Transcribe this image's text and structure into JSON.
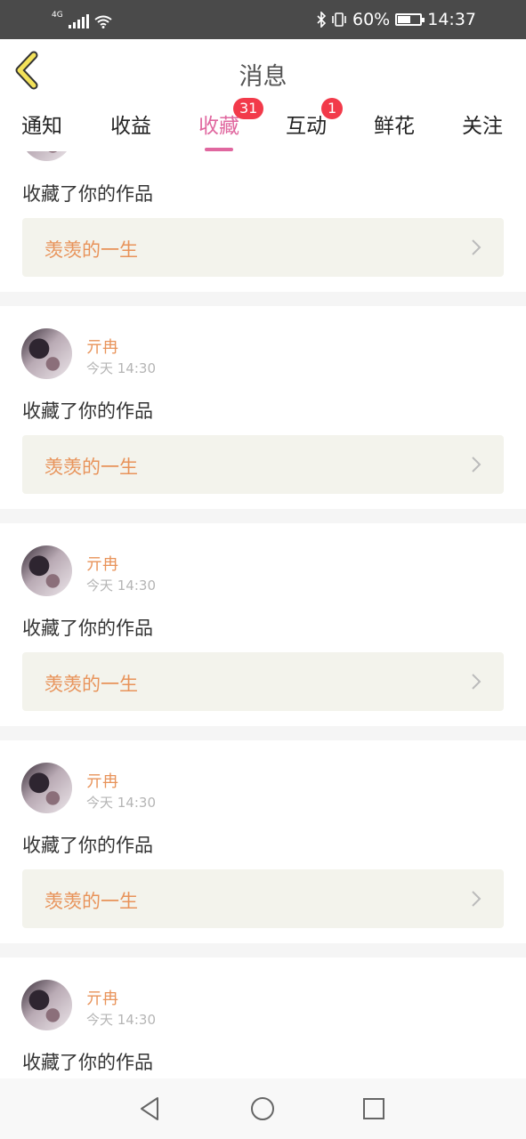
{
  "status_bar": {
    "network": "4G",
    "battery": "60%",
    "battery_level": 0.6,
    "time": "14:37",
    "icons": [
      "signal-icon",
      "wifi-icon",
      "bluetooth-icon",
      "vibrate-icon",
      "battery-icon"
    ]
  },
  "header": {
    "title": "消息",
    "back_icon": "chevron-left-icon"
  },
  "tabs": [
    {
      "label": "通知",
      "badge": "",
      "active": false
    },
    {
      "label": "收益",
      "badge": "",
      "active": false
    },
    {
      "label": "收藏",
      "badge": "31",
      "active": true
    },
    {
      "label": "互动",
      "badge": "1",
      "active": false
    },
    {
      "label": "鲜花",
      "badge": "",
      "active": false
    },
    {
      "label": "关注",
      "badge": "",
      "active": false
    }
  ],
  "colors": {
    "accent": "#e0679f",
    "badge": "#f23a4a",
    "username": "#e8935a",
    "link_bg": "#f3f3ec"
  },
  "feed": {
    "partial_item": {
      "action": "收藏了你的作品",
      "work_title": "羡羡的一生"
    },
    "items": [
      {
        "user": "亓冉",
        "time": "今天 14:30",
        "action": "收藏了你的作品",
        "work_title": "羡羡的一生"
      },
      {
        "user": "亓冉",
        "time": "今天 14:30",
        "action": "收藏了你的作品",
        "work_title": "羡羡的一生"
      },
      {
        "user": "亓冉",
        "time": "今天 14:30",
        "action": "收藏了你的作品",
        "work_title": "羡羡的一生"
      },
      {
        "user": "亓冉",
        "time": "今天 14:30",
        "action": "收藏了你的作品",
        "work_title": ""
      }
    ]
  },
  "nav_bar": {
    "icons": [
      "back-triangle-icon",
      "home-circle-icon",
      "recents-square-icon"
    ]
  }
}
